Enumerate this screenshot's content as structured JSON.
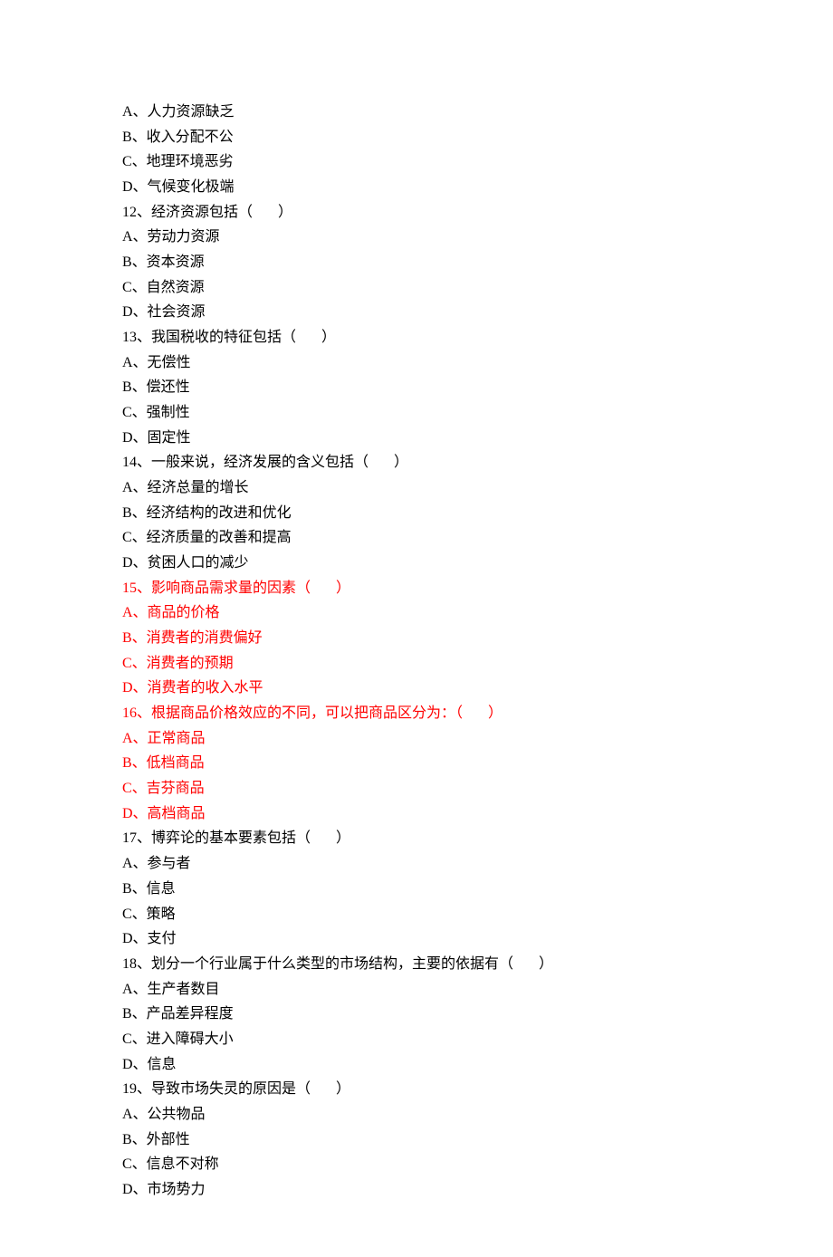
{
  "lines": [
    {
      "text": "A、人力资源缺乏",
      "red": false
    },
    {
      "text": "B、收入分配不公",
      "red": false
    },
    {
      "text": "C、地理环境恶劣",
      "red": false
    },
    {
      "text": "D、气候变化极端",
      "red": false
    },
    {
      "text": "12、经济资源包括（       ）",
      "red": false
    },
    {
      "text": "A、劳动力资源",
      "red": false
    },
    {
      "text": "B、资本资源",
      "red": false
    },
    {
      "text": "C、自然资源",
      "red": false
    },
    {
      "text": "D、社会资源",
      "red": false
    },
    {
      "text": "13、我国税收的特征包括（       ）",
      "red": false
    },
    {
      "text": "A、无偿性",
      "red": false
    },
    {
      "text": "B、偿还性",
      "red": false
    },
    {
      "text": "C、强制性",
      "red": false
    },
    {
      "text": "D、固定性",
      "red": false
    },
    {
      "text": "14、一般来说，经济发展的含义包括（       ）",
      "red": false
    },
    {
      "text": "A、经济总量的增长",
      "red": false
    },
    {
      "text": "B、经济结构的改进和优化",
      "red": false
    },
    {
      "text": "C、经济质量的改善和提高",
      "red": false
    },
    {
      "text": "D、贫困人口的减少",
      "red": false
    },
    {
      "text": "15、影响商品需求量的因素（       ）",
      "red": true
    },
    {
      "text": "A、商品的价格",
      "red": true
    },
    {
      "text": "B、消费者的消费偏好",
      "red": true
    },
    {
      "text": "C、消费者的预期",
      "red": true
    },
    {
      "text": "D、消费者的收入水平",
      "red": true
    },
    {
      "text": "16、根据商品价格效应的不同，可以把商品区分为：（       ）",
      "red": true
    },
    {
      "text": "A、正常商品",
      "red": true
    },
    {
      "text": "B、低档商品",
      "red": true
    },
    {
      "text": "C、吉芬商品",
      "red": true
    },
    {
      "text": "D、高档商品",
      "red": true
    },
    {
      "text": "17、博弈论的基本要素包括（       ）",
      "red": false
    },
    {
      "text": "A、参与者",
      "red": false
    },
    {
      "text": "B、信息",
      "red": false
    },
    {
      "text": "C、策略",
      "red": false
    },
    {
      "text": "D、支付",
      "red": false
    },
    {
      "text": "18、划分一个行业属于什么类型的市场结构，主要的依据有（       ）",
      "red": false
    },
    {
      "text": "A、生产者数目",
      "red": false
    },
    {
      "text": "B、产品差异程度",
      "red": false
    },
    {
      "text": "C、进入障碍大小",
      "red": false
    },
    {
      "text": "D、信息",
      "red": false
    },
    {
      "text": "19、导致市场失灵的原因是（       ）",
      "red": false
    },
    {
      "text": "A、公共物品",
      "red": false
    },
    {
      "text": "B、外部性",
      "red": false
    },
    {
      "text": "C、信息不对称",
      "red": false
    },
    {
      "text": "D、市场势力",
      "red": false
    }
  ]
}
